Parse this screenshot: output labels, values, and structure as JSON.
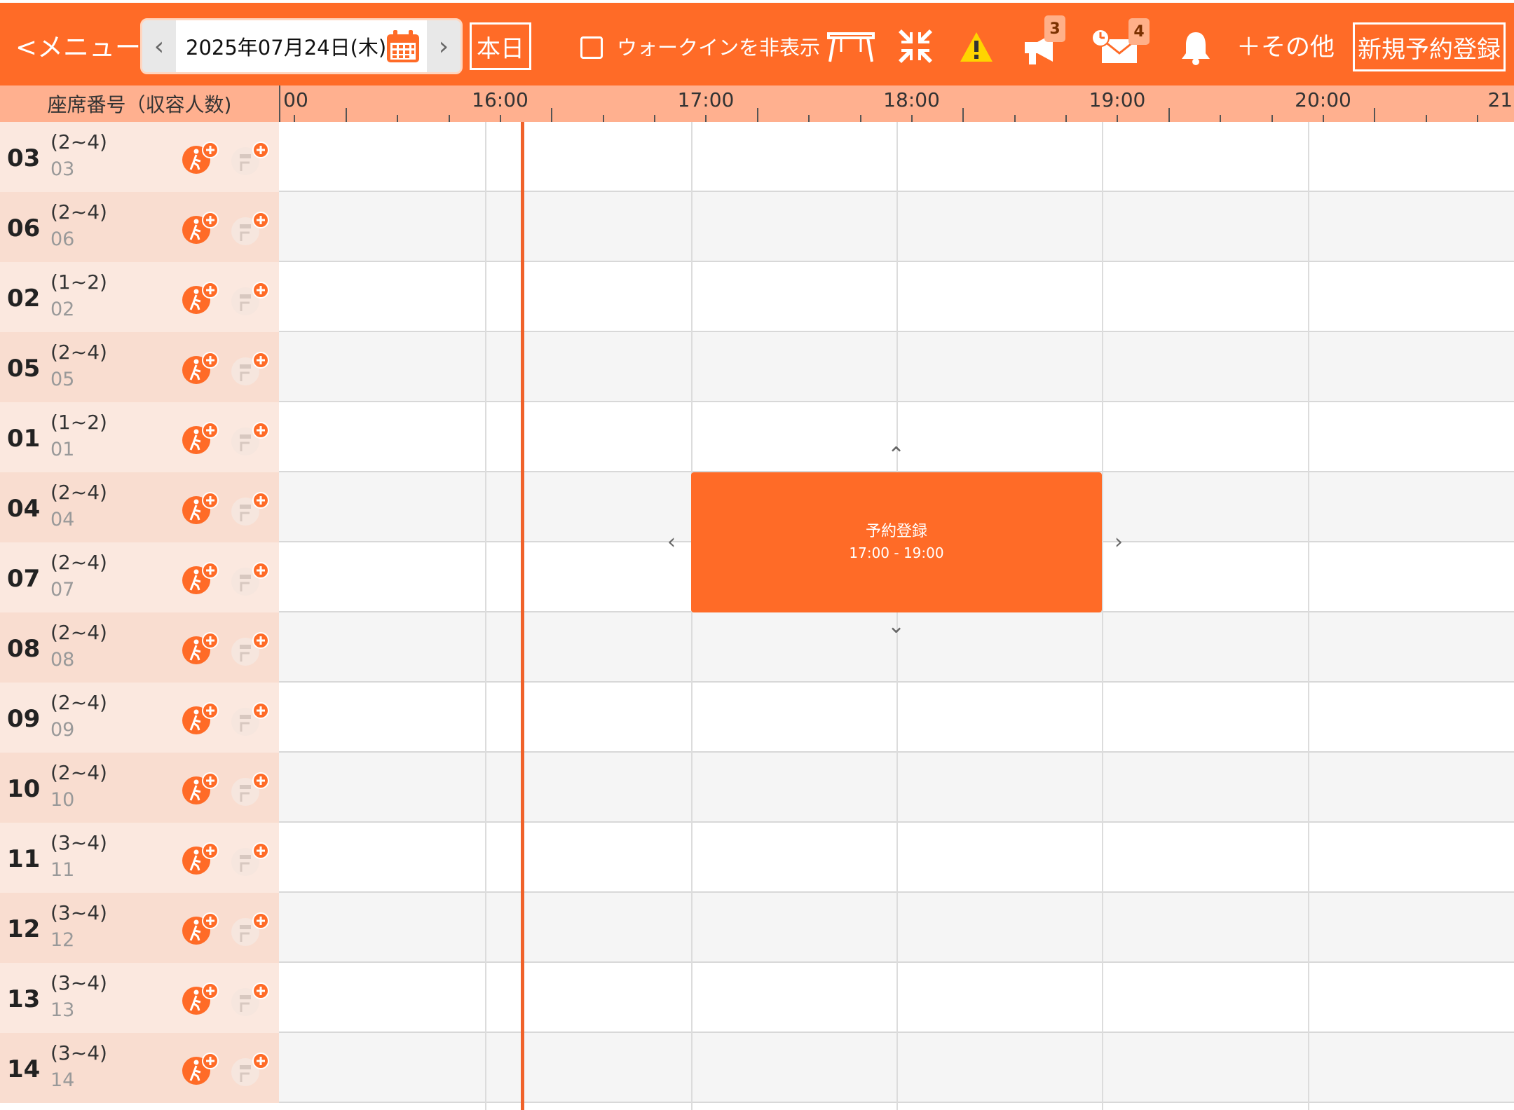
{
  "topbar": {
    "menu_label": "<メニュー",
    "date": "2025年07月24日(木)",
    "today_label": "本日",
    "walkin_hide_label": "ウォークインを非表示",
    "announcement_badge": "3",
    "mail_badge": "4",
    "other_label": "＋その他",
    "new_reservation_label": "新規予約登録",
    "icons": [
      "chevron-left-icon",
      "calendar-icon",
      "chevron-right-icon",
      "table-icon",
      "collapse-icon",
      "warning-icon",
      "megaphone-icon",
      "mail-clock-icon",
      "bell-icon"
    ]
  },
  "header": {
    "seat_column_label": "座席番号（収容人数)",
    "time_labels": [
      "00",
      "16:00",
      "17:00",
      "18:00",
      "19:00",
      "20:00",
      "21:"
    ]
  },
  "rows": [
    {
      "num": "03",
      "cap": "(2~4)",
      "code": "03"
    },
    {
      "num": "06",
      "cap": "(2~4)",
      "code": "06"
    },
    {
      "num": "02",
      "cap": "(1~2)",
      "code": "02"
    },
    {
      "num": "05",
      "cap": "(2~4)",
      "code": "05"
    },
    {
      "num": "01",
      "cap": "(1~2)",
      "code": "01"
    },
    {
      "num": "04",
      "cap": "(2~4)",
      "code": "04"
    },
    {
      "num": "07",
      "cap": "(2~4)",
      "code": "07"
    },
    {
      "num": "08",
      "cap": "(2~4)",
      "code": "08"
    },
    {
      "num": "09",
      "cap": "(2~4)",
      "code": "09"
    },
    {
      "num": "10",
      "cap": "(2~4)",
      "code": "10"
    },
    {
      "num": "11",
      "cap": "(3~4)",
      "code": "11"
    },
    {
      "num": "12",
      "cap": "(3~4)",
      "code": "12"
    },
    {
      "num": "13",
      "cap": "(3~4)",
      "code": "13"
    },
    {
      "num": "14",
      "cap": "(3~4)",
      "code": "14"
    }
  ],
  "reservation": {
    "title": "予約登録",
    "time": "17:00 - 19:00"
  },
  "colors": {
    "accent": "#ff6b27",
    "header_bg": "#ffb08f",
    "now_line": "#f0622a"
  }
}
